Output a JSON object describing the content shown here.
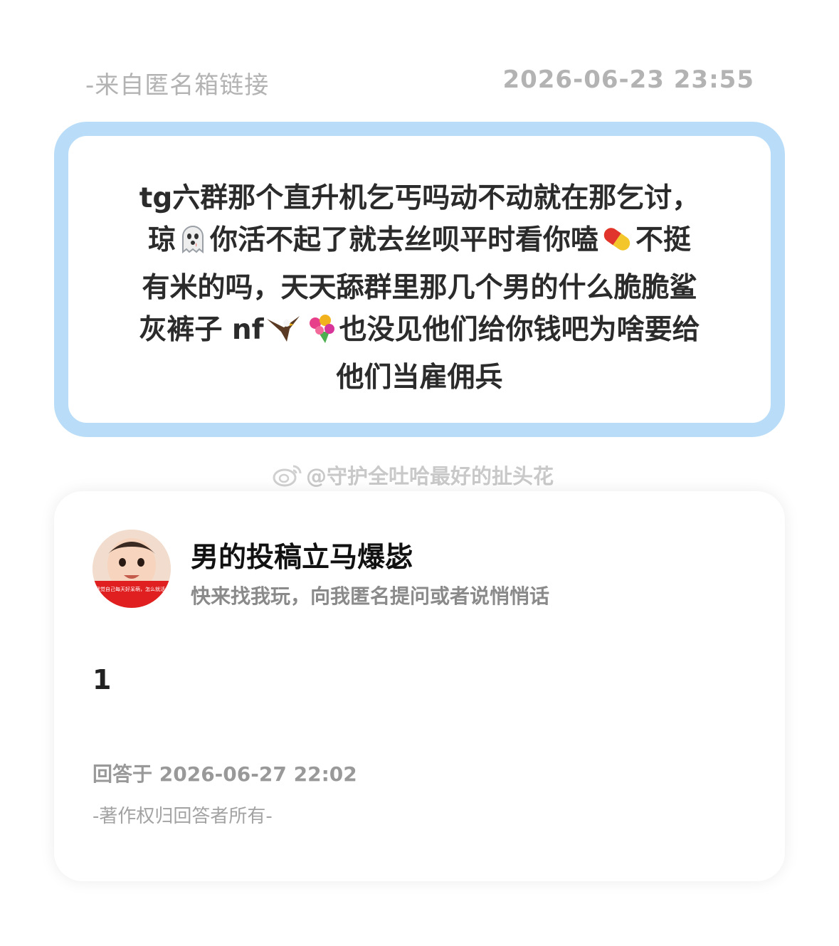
{
  "meta": {
    "source": "-来自匿名箱链接",
    "time": "2026-06-23 23:55"
  },
  "question": {
    "lines": [
      [
        "tg六群那个直升机乞丐吗动不动就在那乞讨，"
      ],
      [
        "琼",
        "ghost-emoji",
        "你活不起了就去丝呗平时看你嗑",
        "pill-emoji",
        "不挺"
      ],
      [
        "有米的吗，天天舔群里那几个男的什么脆脆鲨"
      ],
      [
        "灰裤子 nf",
        "eagle-emoji",
        "bouquet-emoji",
        "也没见他们给你钱吧为啥要给"
      ],
      [
        "他们当雇佣兵"
      ]
    ],
    "seg": {
      "l1": "tg六群那个直升机乞丐吗动不动就在那乞讨，",
      "l2a": "琼",
      "l2b": "你活不起了就去丝呗平时看你嗑",
      "l2c": "不挺",
      "l3": "有米的吗，天天舔群里那几个男的什么脆脆鲨",
      "l4a": "灰裤子 nf",
      "l4b": "也没见他们给你钱吧为啥要给",
      "l5": "他们当雇佣兵"
    }
  },
  "watermark": {
    "text": "@守护全吐哈最好的扯头花",
    "icon": "weibo-icon"
  },
  "profile": {
    "name": "男的投稿立马爆毖",
    "bio": "快来找我玩，向我匿名提问或者说悄悄话",
    "avatar_text": "我觉自己每天好呆萌，怎么就活成这样了"
  },
  "answer": {
    "text": "1",
    "answered_at": "回答于 2026-06-27 22:02",
    "copyright": "-著作权归回答者所有-"
  },
  "colors": {
    "card_border": "#b9ddf8",
    "text": "#2b2b2b",
    "muted": "#b3b3b3"
  }
}
